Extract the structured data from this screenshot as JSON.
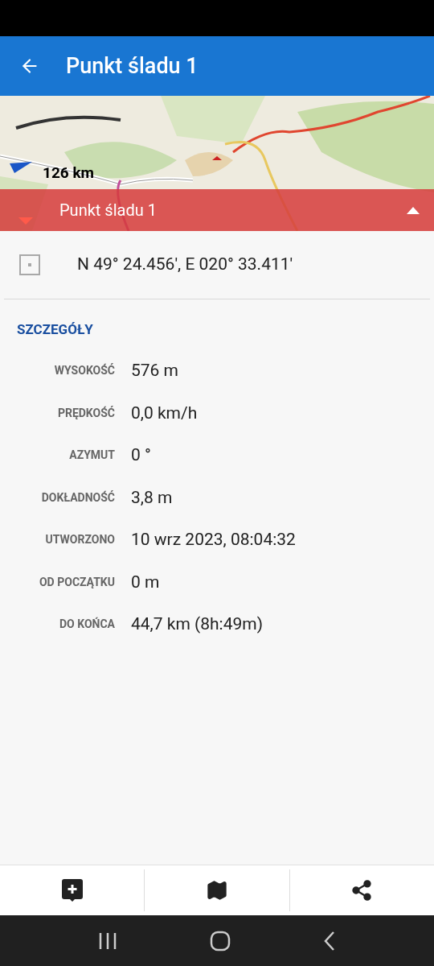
{
  "app_bar": {
    "title": "Punkt śladu 1"
  },
  "map": {
    "distance": "126 km",
    "banner": "Punkt śladu 1"
  },
  "coordinates": "N 49° 24.456', E 020° 33.411'",
  "details": {
    "heading": "SZCZEGÓŁY",
    "rows": [
      {
        "label": "WYSOKOŚĆ",
        "value": "576 m"
      },
      {
        "label": "PRĘDKOŚĆ",
        "value": "0,0 km/h"
      },
      {
        "label": "AZYMUT",
        "value": "0 °"
      },
      {
        "label": "DOKŁADNOŚĆ",
        "value": "3,8 m"
      },
      {
        "label": "UTWORZONO",
        "value": "10 wrz 2023, 08:04:32"
      },
      {
        "label": "OD POCZĄTKU",
        "value": "0 m"
      },
      {
        "label": "DO KOŃCA",
        "value": "44,7 km (8h:49m)"
      }
    ]
  }
}
